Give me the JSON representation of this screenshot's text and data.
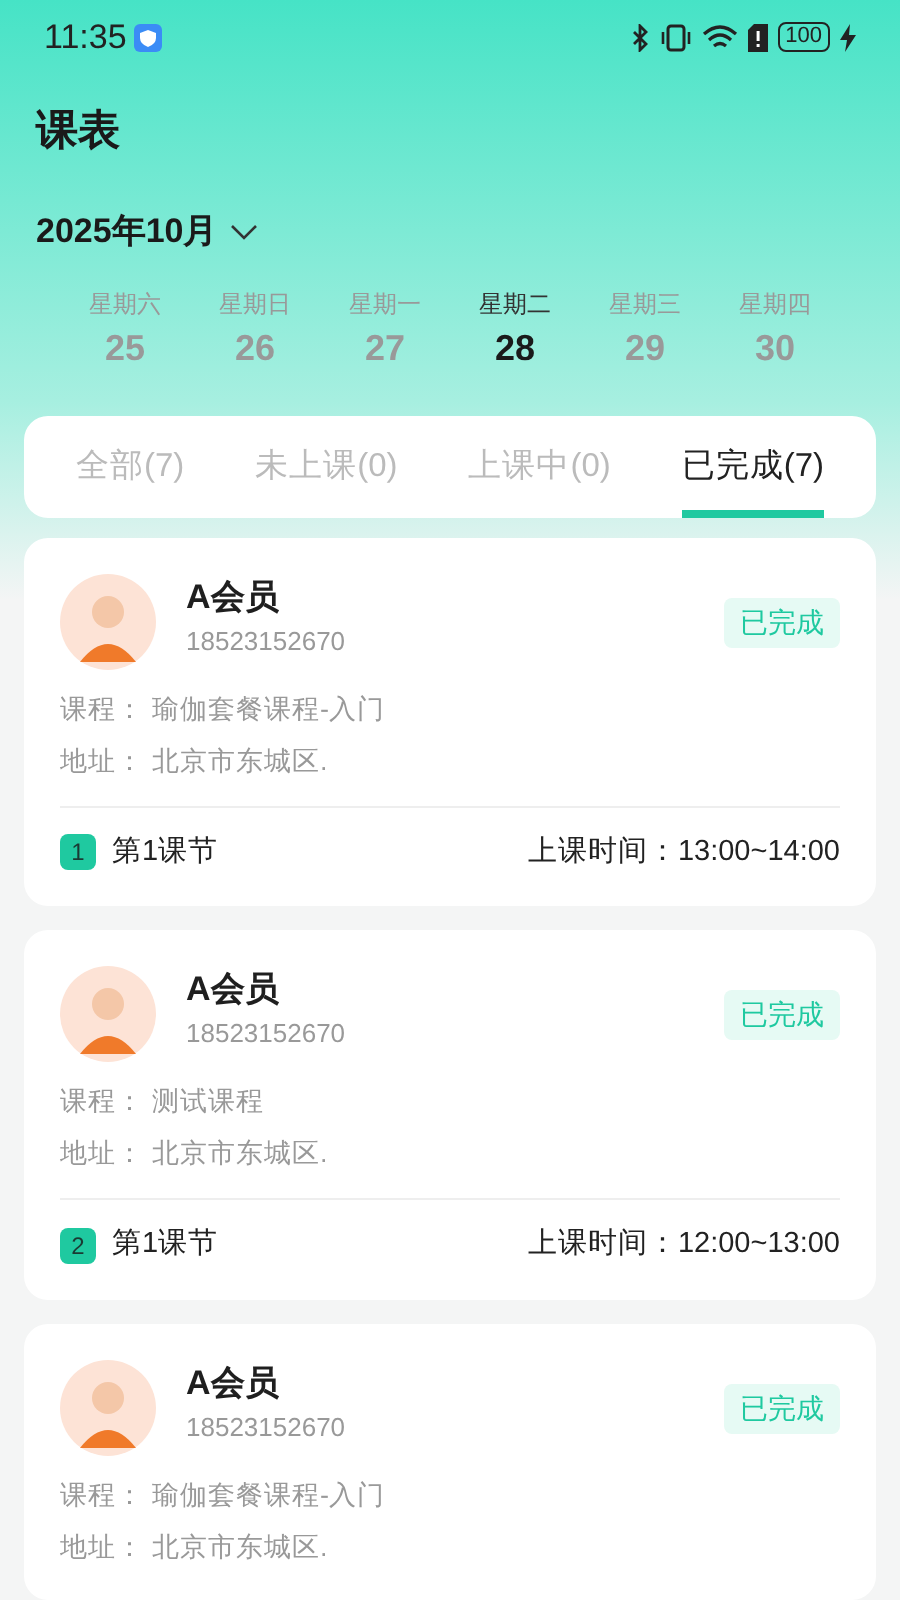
{
  "status_bar": {
    "time": "11:35",
    "battery": "100"
  },
  "title": "课表",
  "month": "2025年10月",
  "days": [
    {
      "weekday": "星期六",
      "date": "25",
      "selected": false
    },
    {
      "weekday": "星期日",
      "date": "26",
      "selected": false
    },
    {
      "weekday": "星期一",
      "date": "27",
      "selected": false
    },
    {
      "weekday": "星期二",
      "date": "28",
      "selected": true
    },
    {
      "weekday": "星期三",
      "date": "29",
      "selected": false
    },
    {
      "weekday": "星期四",
      "date": "30",
      "selected": false
    }
  ],
  "tabs": [
    {
      "label": "全部(7)",
      "selected": false
    },
    {
      "label": "未上课(0)",
      "selected": false
    },
    {
      "label": "上课中(0)",
      "selected": false
    },
    {
      "label": "已完成(7)",
      "selected": true
    }
  ],
  "cards": [
    {
      "name": "A会员",
      "phone": "18523152670",
      "status": "已完成",
      "course_label": "课程：",
      "course": "瑜伽套餐课程-入门",
      "address_label": "地址：",
      "address": "北京市东城区.",
      "index": "1",
      "session": "第1课节",
      "time_label": "上课时间：",
      "time": "13:00~14:00"
    },
    {
      "name": "A会员",
      "phone": "18523152670",
      "status": "已完成",
      "course_label": "课程：",
      "course": "测试课程",
      "address_label": "地址：",
      "address": "北京市东城区.",
      "index": "2",
      "session": "第1课节",
      "time_label": "上课时间：",
      "time": "12:00~13:00"
    },
    {
      "name": "A会员",
      "phone": "18523152670",
      "status": "已完成",
      "course_label": "课程：",
      "course": "瑜伽套餐课程-入门",
      "address_label": "地址：",
      "address": "北京市东城区."
    }
  ]
}
